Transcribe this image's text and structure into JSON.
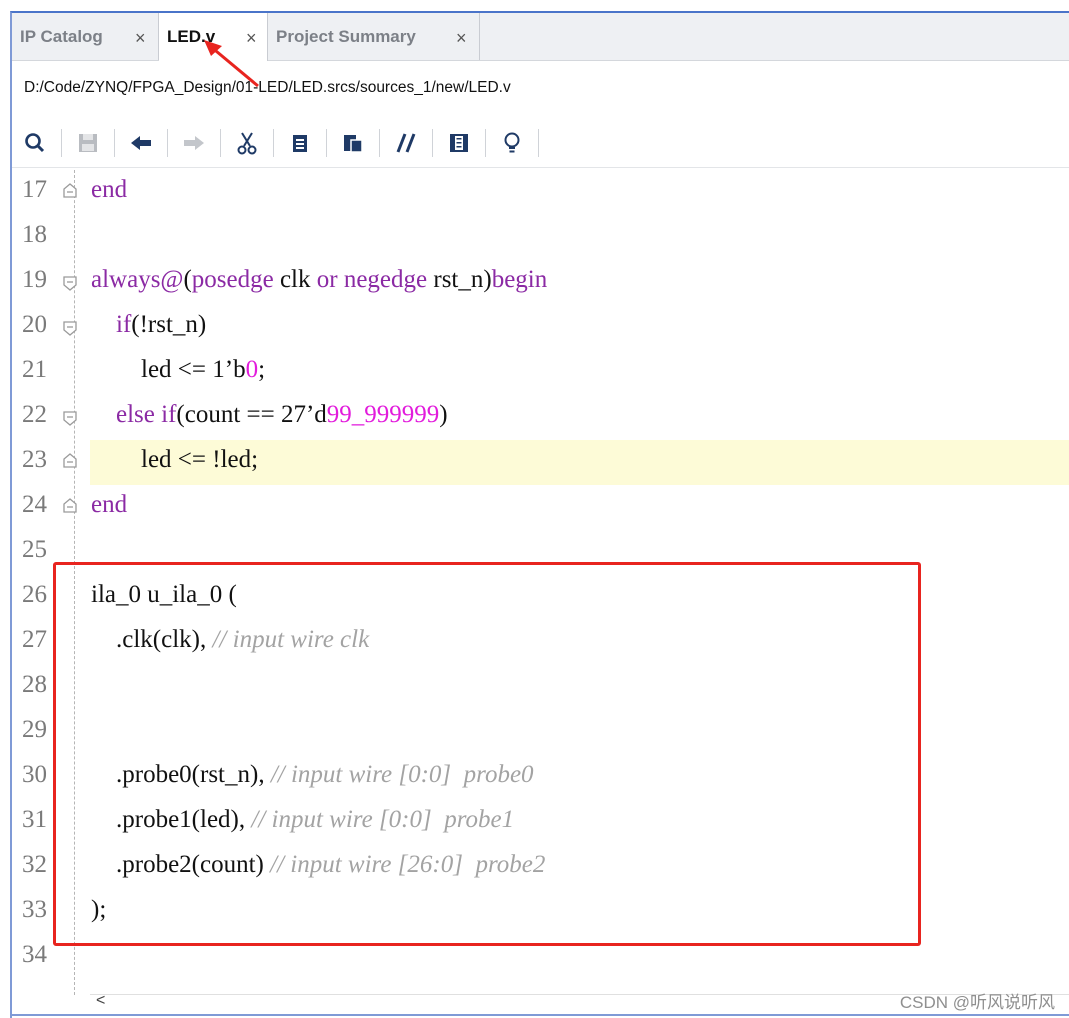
{
  "tabs": [
    {
      "label": "IP Catalog",
      "active": false
    },
    {
      "label": "LED.v",
      "active": true
    },
    {
      "label": "Project Summary",
      "active": false
    }
  ],
  "close_glyph": "×",
  "file_path": "D:/Code/ZYNQ/FPGA_Design/01-LED/LED.srcs/sources_1/new/LED.v",
  "toolbar": {
    "icons": [
      "search-icon",
      "save-icon",
      "undo-icon",
      "redo-icon",
      "cut-icon",
      "copy-icon",
      "paste-icon",
      "comment-toggle-icon",
      "insert-template-icon",
      "lightbulb-icon"
    ]
  },
  "editor": {
    "line_numbers": [
      "17",
      "18",
      "19",
      "20",
      "21",
      "22",
      "23",
      "24",
      "25",
      "26",
      "27",
      "28",
      "29",
      "30",
      "31",
      "32",
      "33",
      "34"
    ],
    "lines": [
      [
        {
          "t": "end",
          "c": "kw"
        }
      ],
      [],
      [
        {
          "t": "always",
          "c": "kw"
        },
        {
          "t": "@",
          "c": "kw"
        },
        {
          "t": "(",
          "c": ""
        },
        {
          "t": "posedge",
          "c": "kw"
        },
        {
          "t": " clk ",
          "c": ""
        },
        {
          "t": "or",
          "c": "kw"
        },
        {
          "t": " ",
          "c": ""
        },
        {
          "t": "negedge",
          "c": "kw"
        },
        {
          "t": " rst_n)",
          "c": ""
        },
        {
          "t": "begin",
          "c": "kw"
        }
      ],
      [
        {
          "t": "    ",
          "c": ""
        },
        {
          "t": "if",
          "c": "kw"
        },
        {
          "t": "(!rst_n)",
          "c": ""
        }
      ],
      [
        {
          "t": "        led <= 1’b",
          "c": ""
        },
        {
          "t": "0",
          "c": "num"
        },
        {
          "t": ";",
          "c": ""
        }
      ],
      [
        {
          "t": "    ",
          "c": ""
        },
        {
          "t": "else",
          "c": "kw"
        },
        {
          "t": " ",
          "c": ""
        },
        {
          "t": "if",
          "c": "kw"
        },
        {
          "t": "(count == 27’d",
          "c": ""
        },
        {
          "t": "99_999999",
          "c": "num"
        },
        {
          "t": ")",
          "c": ""
        }
      ],
      [
        {
          "t": "        led <= !led;",
          "c": ""
        }
      ],
      [
        {
          "t": "end",
          "c": "kw"
        }
      ],
      [],
      [
        {
          "t": "ila_0 u_ila_0 (",
          "c": ""
        }
      ],
      [
        {
          "t": "    .clk(clk), ",
          "c": ""
        },
        {
          "t": "// input wire clk",
          "c": "cmt"
        }
      ],
      [],
      [],
      [
        {
          "t": "    .probe0(rst_n), ",
          "c": ""
        },
        {
          "t": "// input wire [0:0]  probe0",
          "c": "cmt"
        }
      ],
      [
        {
          "t": "    .probe1(led), ",
          "c": ""
        },
        {
          "t": "// input wire [0:0]  probe1",
          "c": "cmt"
        }
      ],
      [
        {
          "t": "    .probe2(count) ",
          "c": ""
        },
        {
          "t": "// input wire [26:0]  probe2",
          "c": "cmt"
        }
      ],
      [
        {
          "t": ");",
          "c": ""
        }
      ],
      []
    ],
    "fold_markers": [
      "end",
      "none",
      "start",
      "start",
      "none",
      "start",
      "end",
      "end",
      "none",
      "none",
      "none",
      "none",
      "none",
      "none",
      "none",
      "none",
      "none",
      "none"
    ],
    "highlighted_line": "23"
  },
  "scroll_left_glyph": "<",
  "watermark": "CSDN @听风说听风",
  "colors": {
    "keyword": "#8b2aa4",
    "number": "#e21bdc",
    "comment": "#a3a3a3",
    "highlight": "#fdfbd7",
    "annotation": "#e8241f"
  }
}
